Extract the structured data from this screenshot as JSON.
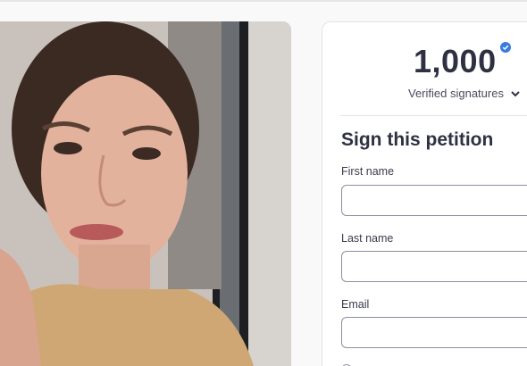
{
  "petition": {
    "signature_count": "1,000",
    "verified_label": "Verified signatures",
    "form_title": "Sign this petition",
    "fields": {
      "first_name_label": "First name",
      "first_name_value": "",
      "last_name_label": "Last name",
      "last_name_value": "",
      "email_label": "Email",
      "email_value": ""
    }
  },
  "colors": {
    "accent_blue": "#3a7be0",
    "text_dark": "#2f3142",
    "border": "#8e8fa0"
  },
  "icons": {
    "verified": "verified-badge-icon",
    "expand": "chevron-down-icon"
  }
}
